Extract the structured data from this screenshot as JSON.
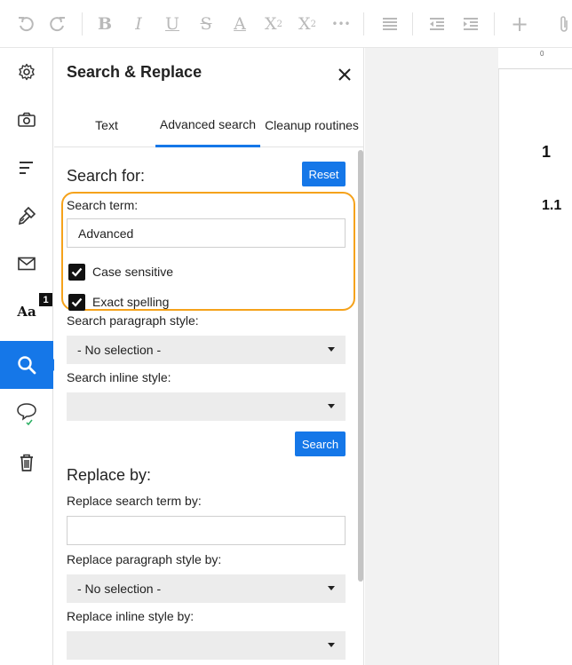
{
  "toolbar": {
    "icons": [
      "undo-icon",
      "redo-icon",
      "bold-icon",
      "italic-icon",
      "underline-icon",
      "strikethrough-icon",
      "text-color-icon",
      "superscript-icon",
      "subscript-icon",
      "more-icon",
      "align-icon",
      "outdent-icon",
      "indent-icon",
      "insert-icon",
      "attachment-icon"
    ],
    "glyphs": {
      "bold": "B",
      "italic": "I",
      "underline": "U",
      "strike": "S",
      "textcolor": "A",
      "superscript": "X",
      "superscript_mark": "2",
      "subscript": "X",
      "subscript_mark": "2",
      "more": "•••",
      "insert": "+"
    }
  },
  "rail": {
    "items": [
      "settings-icon",
      "camera-icon",
      "outline-icon",
      "format-paint-icon",
      "mail-icon",
      "styles-icon",
      "search-icon",
      "comments-icon",
      "trash-icon"
    ],
    "styles_label": "Aa",
    "styles_badge": "1",
    "active_item": "search-icon",
    "accent_color": "#1577e8"
  },
  "panel": {
    "title": "Search & Replace",
    "tabs": [
      {
        "label": "Text",
        "active": false
      },
      {
        "label": "Advanced search",
        "active": true
      },
      {
        "label": "Cleanup routines",
        "active": false
      }
    ],
    "search": {
      "heading": "Search for:",
      "reset_label": "Reset",
      "term_label": "Search term:",
      "term_value": "Advanced",
      "case_sensitive_label": "Case sensitive",
      "case_sensitive_checked": true,
      "exact_spelling_label": "Exact spelling",
      "exact_spelling_checked": true,
      "paragraph_style_label": "Search paragraph style:",
      "paragraph_style_value": "- No selection -",
      "inline_style_label": "Search inline style:",
      "inline_style_value": "",
      "search_button_label": "Search"
    },
    "replace": {
      "heading": "Replace by:",
      "term_label": "Replace search term by:",
      "term_value": "",
      "paragraph_style_label": "Replace paragraph style by:",
      "paragraph_style_value": "- No selection -",
      "inline_style_label": "Replace inline style by:",
      "inline_style_value": ""
    },
    "highlight_color": "#f5a21b"
  },
  "document": {
    "ruler_zero": "0",
    "heading_1": "1",
    "heading_1_1": "1.1"
  }
}
